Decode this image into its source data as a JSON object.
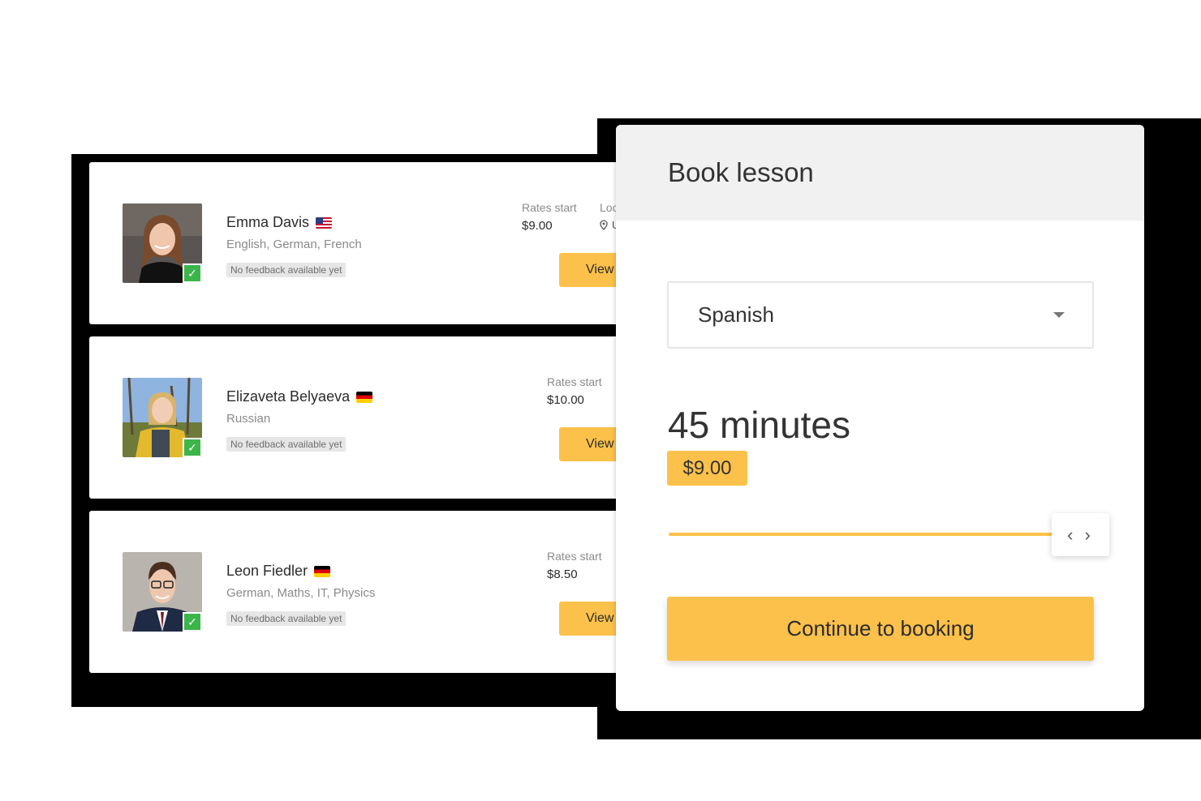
{
  "tutors": [
    {
      "name": "Emma Davis",
      "flag": "us",
      "subjects": "English, German, French",
      "feedback": "No feedback available yet",
      "rates_label": "Rates start",
      "rate": "$9.00",
      "location_label": "Loc",
      "location_value": "U",
      "view_label": "View"
    },
    {
      "name": "Elizaveta Belyaeva",
      "flag": "de",
      "subjects": "Russian",
      "feedback": "No feedback available yet",
      "rates_label": "Rates start",
      "rate": "$10.00",
      "view_label": "View"
    },
    {
      "name": "Leon Fiedler",
      "flag": "de",
      "subjects": "German, Maths, IT, Physics",
      "feedback": "No feedback available yet",
      "rates_label": "Rates start",
      "rate": "$8.50",
      "view_label": "View"
    }
  ],
  "booking": {
    "title": "Book lesson",
    "language": "Spanish",
    "duration": "45 minutes",
    "price": "$9.00",
    "slider_handle": "‹ ›",
    "continue_label": "Continue to booking"
  },
  "colors": {
    "accent": "#fcc14a",
    "verified": "#3cb54a",
    "header_bg": "#f1f1f1"
  },
  "icons": {
    "verified": "check-icon",
    "location": "map-pin-icon",
    "dropdown": "chevron-down-icon",
    "slider": "code-arrows-icon"
  }
}
